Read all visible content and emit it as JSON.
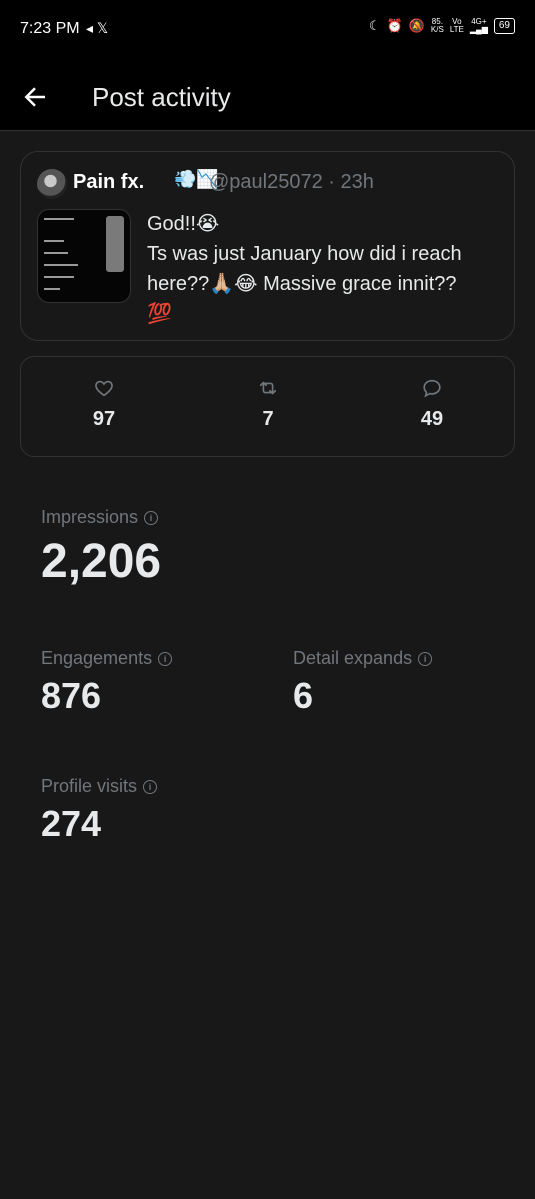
{
  "status_bar": {
    "time": "7:23 PM",
    "left_icons": "◂ 𝕏",
    "speed_top": "85.",
    "speed_bottom": "K/S",
    "net_top": "Vo",
    "net_bottom": "LTE",
    "gen_top": "4G+",
    "battery": "69"
  },
  "header": {
    "title": "Post activity"
  },
  "post": {
    "author_name": "Pain fx.",
    "author_emoji": "💨📉",
    "handle_time": "@paul25072 · 23h",
    "text_line1": "God!!😭",
    "text_line2": "Ts was just January how did i reach here??🙏🏼😂 Massive grace innit??",
    "text_line3": "💯"
  },
  "counts": {
    "likes": "97",
    "reposts": "7",
    "replies": "49"
  },
  "metrics": {
    "impressions_label": "Impressions",
    "impressions_value": "2,206",
    "engagements_label": "Engagements",
    "engagements_value": "876",
    "detail_expands_label": "Detail expands",
    "detail_expands_value": "6",
    "profile_visits_label": "Profile visits",
    "profile_visits_value": "274"
  }
}
